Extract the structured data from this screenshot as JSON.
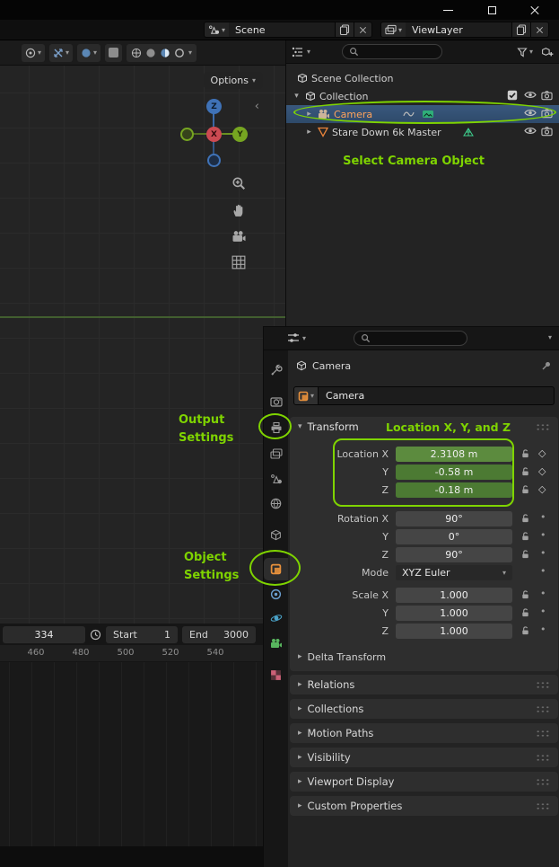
{
  "colors": {
    "annotation": "#7fd400",
    "selected_row": "#33506e",
    "selected_object_text": "#ffa35c",
    "animated_field": "#4c7a33",
    "axis_x": "#cc4a52",
    "axis_y": "#76a521",
    "axis_z": "#3f72b7",
    "object_tab_orange": "#e8913c"
  },
  "icons": {
    "chevron_down": "▾",
    "chevron_right": "▸",
    "collapse_left": "‹",
    "dot": "•",
    "diamond": "◇"
  },
  "topbar": {
    "scene_name": "Scene",
    "viewlayer_name": "ViewLayer"
  },
  "viewport": {
    "options_label": "Options",
    "gizmo": {
      "x": "X",
      "y": "Y",
      "z": "Z"
    }
  },
  "timeline": {
    "current_frame": "334",
    "start_label": "Start",
    "start_value": "1",
    "end_label": "End",
    "end_value": "3000",
    "ticks": [
      "460",
      "480",
      "500",
      "520",
      "540"
    ]
  },
  "outliner": {
    "rows": [
      {
        "label": "Scene Collection"
      },
      {
        "label": "Collection"
      },
      {
        "label": "Camera"
      },
      {
        "label": "Stare Down 6k Master"
      }
    ]
  },
  "properties": {
    "breadcrumb_object": "Camera",
    "object_name": "Camera",
    "tabs": [
      "tool",
      "render",
      "output",
      "view-layer",
      "scene",
      "world",
      "collection",
      "object",
      "constraints",
      "physics",
      "object-data",
      "texture"
    ],
    "transform": {
      "title": "Transform",
      "location": [
        {
          "label": "Location X",
          "value": "2.3108 m"
        },
        {
          "label": "Y",
          "value": "-0.58 m"
        },
        {
          "label": "Z",
          "value": "-0.18 m"
        }
      ],
      "rotation": [
        {
          "label": "Rotation X",
          "value": "90°"
        },
        {
          "label": "Y",
          "value": "0°"
        },
        {
          "label": "Z",
          "value": "90°"
        }
      ],
      "mode_label": "Mode",
      "mode_value": "XYZ Euler",
      "scale": [
        {
          "label": "Scale X",
          "value": "1.000"
        },
        {
          "label": "Y",
          "value": "1.000"
        },
        {
          "label": "Z",
          "value": "1.000"
        }
      ],
      "delta_label": "Delta Transform"
    },
    "sections": [
      "Relations",
      "Collections",
      "Motion Paths",
      "Visibility",
      "Viewport Display",
      "Custom Properties"
    ]
  },
  "annotations": {
    "select_camera": "Select Camera Object",
    "output_settings_line1": "Output",
    "output_settings_line2": "Settings",
    "object_settings_line1": "Object",
    "object_settings_line2": "Settings",
    "location_note": "Location X, Y, and Z"
  }
}
